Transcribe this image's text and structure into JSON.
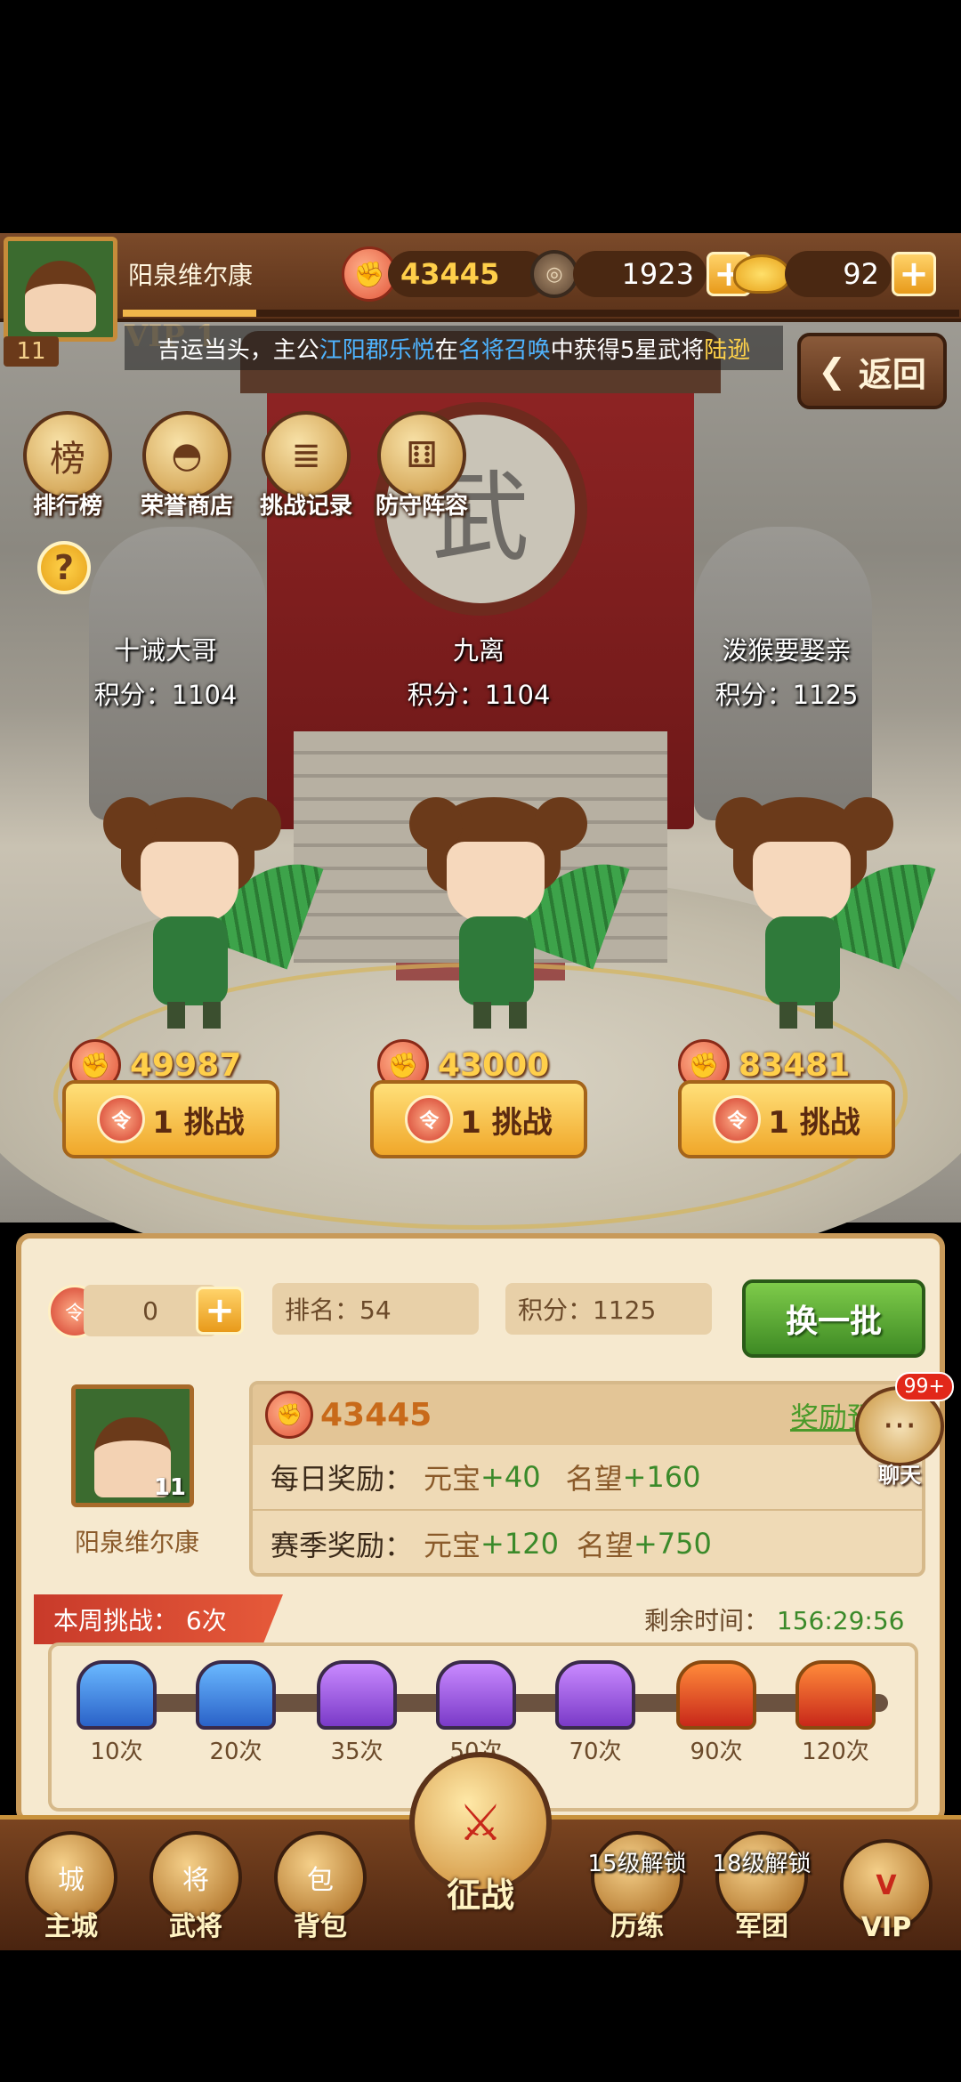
{
  "player": {
    "name": "阳泉维尔康",
    "level": "11",
    "vip": "VIP 1",
    "exp_fraction": 0.16
  },
  "resources": {
    "power": "43445",
    "copper": "1923",
    "gold": "92"
  },
  "ticker": {
    "part1": "吉运当头，主公",
    "player": "江阳郡乐悦",
    "part2": "在",
    "source": "名将召唤",
    "part3": "中获得5星武将",
    "hero": "陆逊"
  },
  "back_label": "返回",
  "features": [
    {
      "label": "排行榜",
      "icon": "leaderboard-scroll-icon"
    },
    {
      "label": "荣誉商店",
      "icon": "honor-shop-bowl-icon"
    },
    {
      "label": "挑战记录",
      "icon": "challenge-record-scroll-icon"
    },
    {
      "label": "防守阵容",
      "icon": "defense-lineup-icon"
    }
  ],
  "help_label": "?",
  "opponents": [
    {
      "name": "十诫大哥",
      "score": "积分：1104",
      "power": "49987",
      "button": "1 挑战"
    },
    {
      "name": "九离",
      "score": "积分：1104",
      "power": "43000",
      "button": "1 挑战"
    },
    {
      "name": "泼猴要娶亲",
      "score": "积分：1125",
      "power": "83481",
      "button": "1 挑战"
    }
  ],
  "panel": {
    "tickets": "0",
    "rank": "排名：54",
    "score": "积分：1125",
    "refresh": "换一批",
    "self_name": "阳泉维尔康",
    "self_level": "11",
    "self_power": "43445",
    "reward_preview": "奖励预览",
    "daily_label": "每日奖励：",
    "daily_gold_name": "元宝",
    "daily_gold_val": "+40",
    "daily_fame_name": "名望",
    "daily_fame_val": "+160",
    "season_label": "赛季奖励：",
    "season_gold_name": "元宝",
    "season_gold_val": "+120",
    "season_fame_name": "名望",
    "season_fame_val": "+750",
    "week_challenge": "本周挑战： 6次",
    "remain_label": "剩余时间：",
    "remain_value": "156:29:56"
  },
  "chests": [
    {
      "count": "10次",
      "color": "blue"
    },
    {
      "count": "20次",
      "color": "blue"
    },
    {
      "count": "35次",
      "color": "purple"
    },
    {
      "count": "50次",
      "color": "purple"
    },
    {
      "count": "70次",
      "color": "purple"
    },
    {
      "count": "90次",
      "color": "red"
    },
    {
      "count": "120次",
      "color": "red"
    }
  ],
  "chat": {
    "badge": "99+",
    "label": "聊天"
  },
  "nav": {
    "main_city": "主城",
    "generals": "武将",
    "bag": "背包",
    "campaign": "征战",
    "training": "历练",
    "training_lock": "15级解锁",
    "legion": "军团",
    "legion_lock": "18级解锁",
    "vip": "VIP"
  },
  "colors": {
    "accent_gold": "#f0a72a",
    "refresh_green": "#3e8a24",
    "ticker_blue": "#4fb4ff",
    "ticker_yellow": "#ffd24a"
  }
}
